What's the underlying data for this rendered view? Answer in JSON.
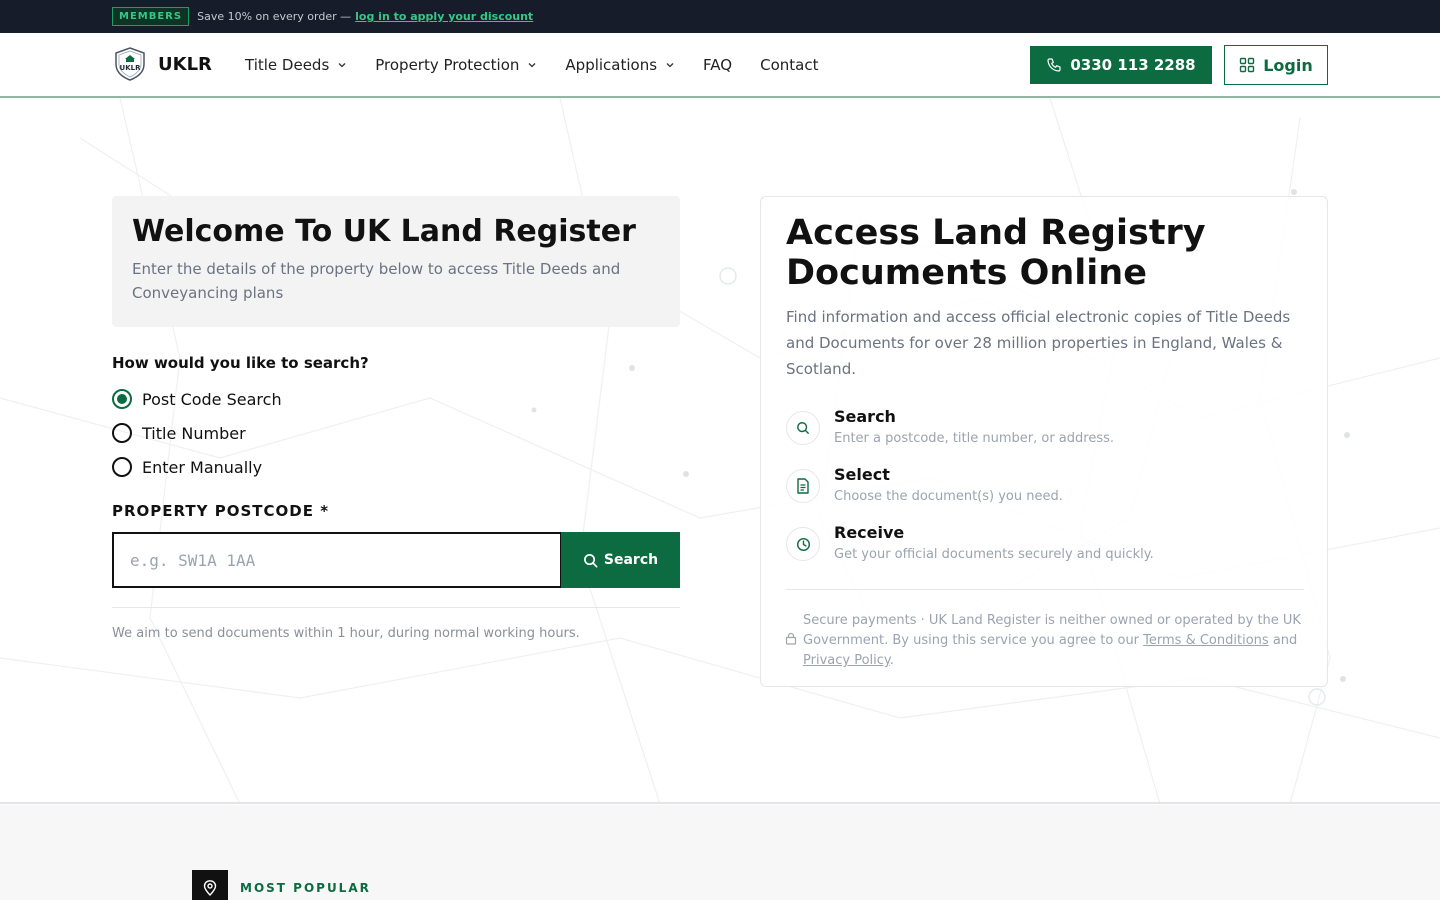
{
  "topbar": {
    "badge": "MEMBERS",
    "text": "Save 10% on every order —",
    "link": "log in to apply your discount"
  },
  "header": {
    "logo_badge": "UKLR",
    "logo_text": "UKLR",
    "nav": [
      {
        "label": "Title Deeds",
        "dropdown": true
      },
      {
        "label": "Property Protection",
        "dropdown": true
      },
      {
        "label": "Applications",
        "dropdown": true
      },
      {
        "label": "FAQ",
        "dropdown": false
      },
      {
        "label": "Contact",
        "dropdown": false
      }
    ],
    "phone": "0330 113 2288",
    "login": "Login"
  },
  "welcome": {
    "title": "Welcome To UK Land Register",
    "subtitle": "Enter the details of the property below to access Title Deeds and Conveyancing plans"
  },
  "search_form": {
    "question": "How would you like to search?",
    "options": [
      {
        "label": "Post Code Search",
        "checked": true
      },
      {
        "label": "Title Number",
        "checked": false
      },
      {
        "label": "Enter Manually",
        "checked": false
      }
    ],
    "postcode_label": "PROPERTY POSTCODE *",
    "postcode_placeholder": "e.g. SW1A 1AA",
    "postcode_value": "",
    "search_button": "Search",
    "note": "We aim to send documents within 1 hour, during normal working hours."
  },
  "access": {
    "title": "Access Land Registry Documents Online",
    "subtitle": "Find information and access official electronic copies of Title Deeds and Documents for over 28 million properties in England, Wales & Scotland.",
    "steps": [
      {
        "title": "Search",
        "desc": "Enter a postcode, title number, or address.",
        "icon": "search-icon"
      },
      {
        "title": "Select",
        "desc": "Choose the document(s) you need.",
        "icon": "document-icon"
      },
      {
        "title": "Receive",
        "desc": "Get your official documents securely and quickly.",
        "icon": "clock-icon"
      }
    ],
    "secure_prefix": "Secure payments · UK Land Register is neither owned or operated by the UK Government. By using this service you agree to our",
    "terms_link": "Terms & Conditions",
    "and_text": "and",
    "privacy_link": "Privacy Policy",
    "period": "."
  },
  "popular": {
    "label": "MOST POPULAR"
  },
  "colors": {
    "brand_green": "#0d6b41",
    "topbar_bg": "#161c2a",
    "accent_green": "#35c785"
  }
}
